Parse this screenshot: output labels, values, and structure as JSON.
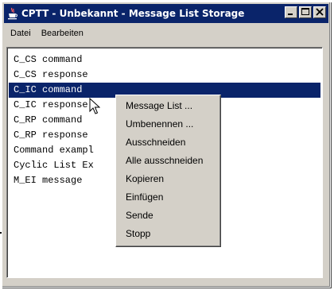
{
  "window": {
    "title": "CPTT - Unbekannt - Message List Storage",
    "icon": "java-cup-icon",
    "buttons": [
      "minimize-icon",
      "maximize-icon",
      "close-icon"
    ]
  },
  "menubar": {
    "items": [
      "Datei",
      "Bearbeiten"
    ]
  },
  "list": {
    "items": [
      "C_CS command",
      "C_CS response",
      "C_IC command",
      "C_IC response",
      "C_RP command",
      "C_RP response",
      "Command exampl",
      "Cyclic List Ex",
      "M_EI message"
    ],
    "selected_index": 2
  },
  "context_menu": {
    "items": [
      "Message List ...",
      "Umbenennen ...",
      "Ausschneiden",
      "Alle ausschneiden",
      "Kopieren",
      "Einfügen",
      "Sende",
      "Stopp"
    ]
  },
  "colors": {
    "titlebar": "#0a246a",
    "selection": "#0a246a",
    "face": "#d4d0c8",
    "list_background": "#ffffff"
  }
}
